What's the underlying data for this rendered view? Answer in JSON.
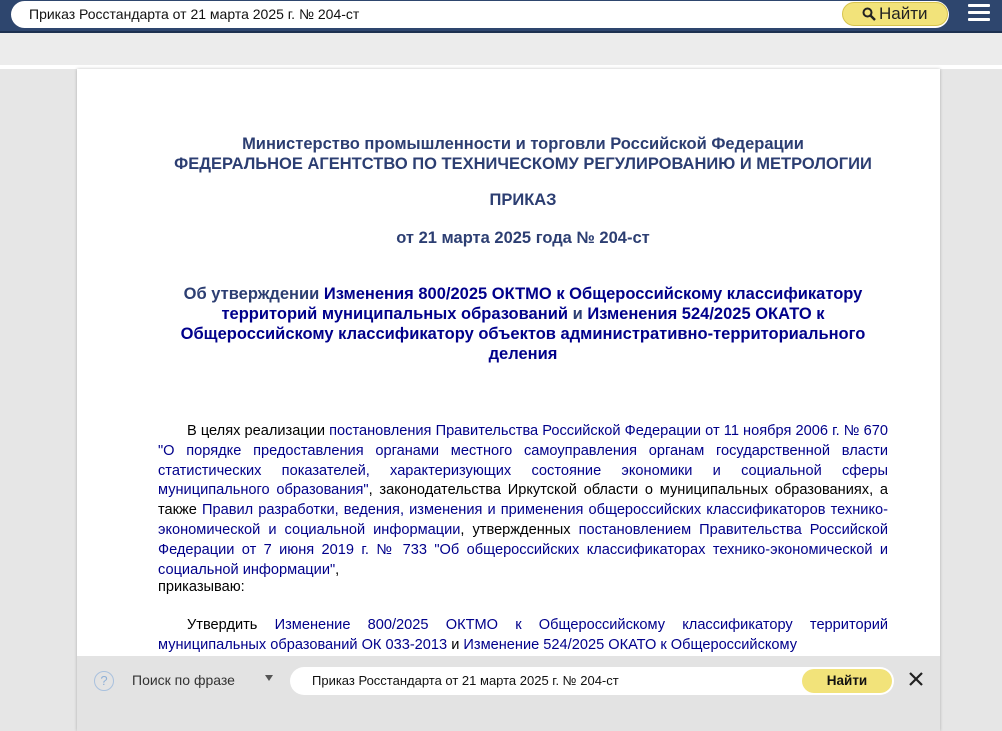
{
  "search": {
    "query": "Приказ Росстандарта от 21 марта 2025 г. № 204-ст",
    "button_label": "Найти"
  },
  "document": {
    "ministry_line": "Министерство промышленности и торговли Российской Федерации",
    "agency_line": "ФЕДЕРАЛЬНОЕ АГЕНТСТВО ПО ТЕХНИЧЕСКОМУ РЕГУЛИРОВАНИЮ И МЕТРОЛОГИИ",
    "order_word": "ПРИКАЗ",
    "order_date": "от 21 марта 2025 года № 204-ст",
    "subject_prefix": "Об утверждении ",
    "subject_link1": "Изменения 800/2025 ОКТМО к Общероссийскому классификатору территорий муниципальных образований",
    "subject_and": " и ",
    "subject_link2": "Изменения 524/2025 ОКАТО к Общероссийскому классификатору объектов административно-территориального деления",
    "para1": {
      "t1": "В целях реализации ",
      "l1": "постановления Правительства Российской Федерации от 11 ноября 2006 г. № 670 \"О порядке предоставления органами местного самоуправления органам государственной власти статистических показателей, характеризующих состояние экономики и социальной сферы муниципального образования\"",
      "t2": ", законодательства Иркутской области о муниципальных образованиях, а также ",
      "l2": "Правил разработки, ведения, изменения и применения общероссийских классификаторов технико-экономической и социальной информации",
      "t3": ", утвержденных ",
      "l3": "постановлением Правительства Российской Федерации от 7 июня 2019 г. № 733 \"Об общероссийских классификаторах технико-экономической и социальной информации\"",
      "t4": ","
    },
    "para2": "приказываю:",
    "para3": {
      "t1": "Утвердить ",
      "l1": "Изменение 800/2025 ОКТМО к Общероссийскому классификатору территорий муниципальных образований ОК 033-2013",
      "t2": " и ",
      "l2": "Изменение 524/2025 ОКАТО к Общероссийскому"
    }
  },
  "findbar": {
    "help_symbol": "?",
    "mode": "Поиск по фразе",
    "query": "Приказ Росстандарта от 21 марта 2025 г. № 204-ст",
    "button_label": "Найти"
  },
  "colors": {
    "topbar": "#2e466e",
    "heading": "#2c3e72",
    "link": "#00008b",
    "button": "#f2e37a"
  },
  "icons": [
    "search-icon",
    "menu-icon",
    "help-icon",
    "chevron-down-icon",
    "close-icon"
  ]
}
